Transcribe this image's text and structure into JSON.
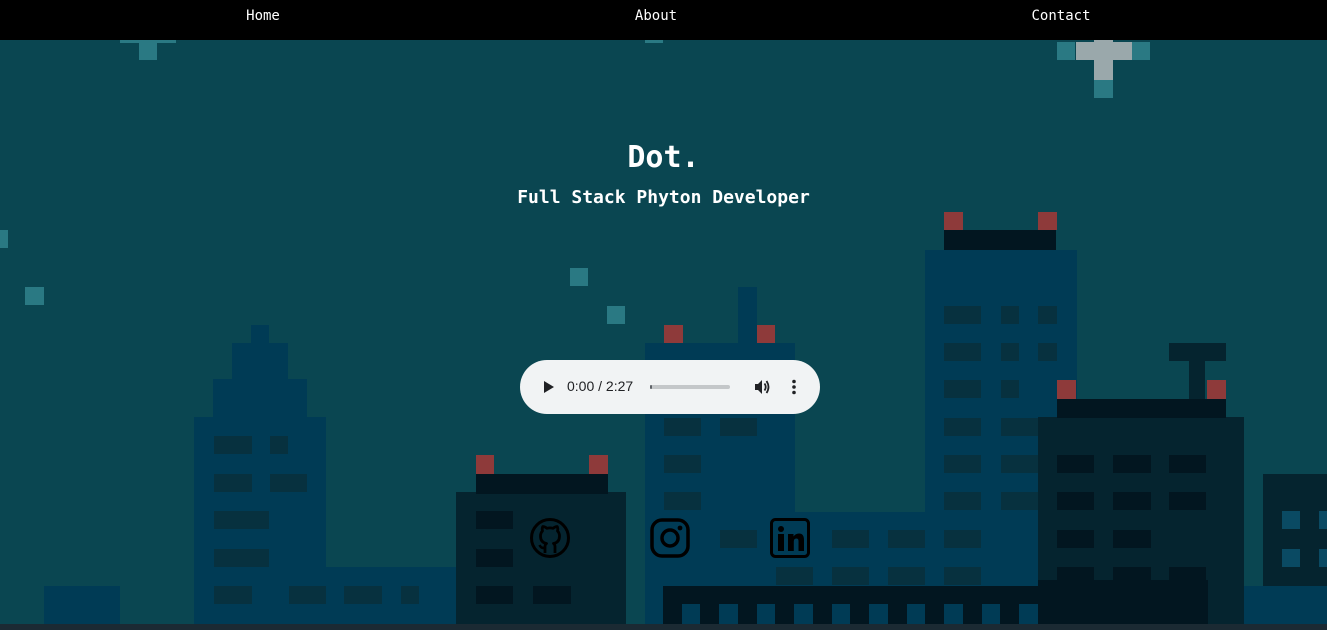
{
  "nav": {
    "items": [
      {
        "label": "Home"
      },
      {
        "label": "About"
      },
      {
        "label": "Contact"
      }
    ]
  },
  "hero": {
    "title": "Dot.",
    "subtitle": "Full Stack Phyton Developer"
  },
  "audio": {
    "time_display": "0:00 / 2:27",
    "progress": 0
  },
  "social": [
    {
      "icon": "github-icon"
    },
    {
      "icon": "instagram-icon"
    },
    {
      "icon": "linkedin-icon"
    }
  ],
  "colors": {
    "sky": "#0a4651",
    "navbar": "#000000",
    "text": "#ffffff",
    "player_bg": "#f1f3f4",
    "antenna_light": "#8e3a3a"
  }
}
